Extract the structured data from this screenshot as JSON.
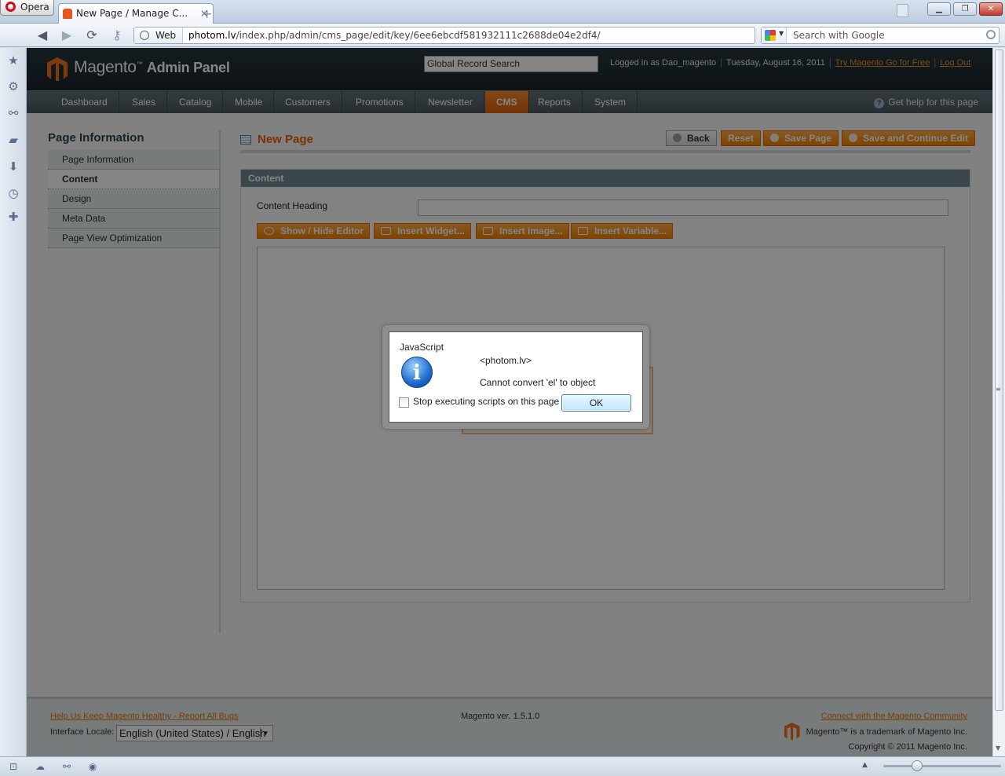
{
  "browser": {
    "menu_label": "Opera",
    "tab_title": "New Page / Manage C...",
    "tab_close": "×",
    "new_tab": "+",
    "address_prefix": "Web",
    "url_host": "photom.lv",
    "url_path": "/index.php/admin/cms_page/edit/key/6ee6ebcdf581932111c2688de04e2df4/",
    "search_placeholder": "Search with Google",
    "window_controls": [
      "minimize",
      "restore",
      "close"
    ]
  },
  "header": {
    "logo_word": "Magento",
    "logo_sub": "Admin Panel",
    "global_search": "Global Record Search",
    "logged_in": "Logged in as Dao_magento",
    "date": "Tuesday, August 16, 2011",
    "try_link": "Try Magento Go for Free",
    "logout_link": "Log Out"
  },
  "nav": {
    "items": [
      "Dashboard",
      "Sales",
      "Catalog",
      "Mobile",
      "Customers",
      "Promotions",
      "Newsletter",
      "CMS",
      "Reports",
      "System"
    ],
    "active": "CMS",
    "help": "Get help for this page"
  },
  "sidebar": {
    "title": "Page Information",
    "items": [
      "Page Information",
      "Content",
      "Design",
      "Meta Data",
      "Page View Optimization"
    ],
    "active": "Content"
  },
  "main": {
    "title": "New Page",
    "buttons": {
      "back": "Back",
      "reset": "Reset",
      "save": "Save Page",
      "save_continue": "Save and Continue Edit"
    },
    "section_title": "Content",
    "heading_label": "Content Heading",
    "heading_value": "",
    "editor_buttons": [
      "Show / Hide Editor",
      "Insert Widget...",
      "Insert Image...",
      "Insert Variable..."
    ]
  },
  "footer": {
    "bugs_link": "Help Us Keep Magento Healthy - Report All Bugs",
    "version": "Magento ver. 1.5.1.0",
    "community_link": "Connect with the Magento Community",
    "locale_label": "Interface Locale:",
    "locale_value": "English (United States) / English",
    "trademark": "Magento™ is a trademark of Magento Inc.",
    "copyright": "Copyright © 2011 Magento Inc."
  },
  "dialog": {
    "title": "JavaScript",
    "origin": "<photom.lv>",
    "message": "Cannot convert 'el' to object",
    "checkbox_label": "Stop executing scripts on this page",
    "checkbox_checked": false,
    "ok": "OK"
  },
  "colors": {
    "accent": "#eb5e00",
    "button_orange": "#f18200",
    "header_dark": "#1a2329",
    "section_head": "#6f8992"
  }
}
